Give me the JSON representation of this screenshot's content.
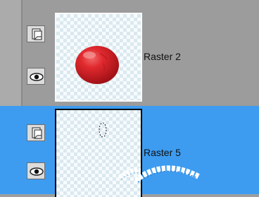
{
  "layers_panel": {
    "layers": [
      {
        "name": "Raster 2",
        "selected": false,
        "visible": true
      },
      {
        "name": "Raster 5",
        "selected": true,
        "visible": true
      }
    ]
  },
  "colors": {
    "panel_background": "#9c9c9c",
    "selection_highlight": "#3d9cf0",
    "thumbnail_ball": "#d8232a"
  },
  "icons": {
    "layer_toggle": "layer-page-icon",
    "visibility": "eye-icon"
  }
}
